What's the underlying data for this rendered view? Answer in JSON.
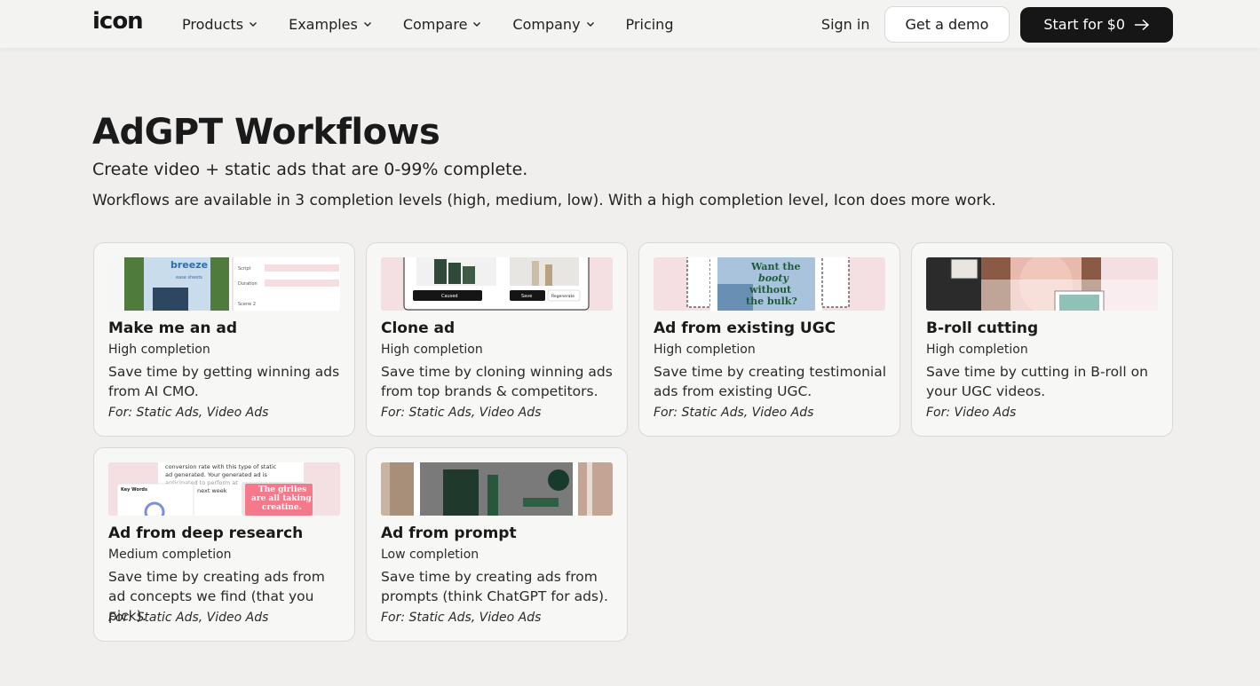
{
  "nav": {
    "logo": "icon",
    "items": [
      {
        "label": "Products"
      },
      {
        "label": "Examples"
      },
      {
        "label": "Compare"
      },
      {
        "label": "Company"
      },
      {
        "label": "Pricing"
      }
    ],
    "signin": "Sign in",
    "demo": "Get a demo",
    "start": "Start for $0"
  },
  "hero": {
    "title": "AdGPT Workflows",
    "subtitle": "Create video + static ads that are 0-99% complete.",
    "description": "Workflows are available in 3 completion levels (high, medium, low). With a high completion level, Icon does more work."
  },
  "cards": [
    {
      "title": "Make me an ad",
      "level": "High completion",
      "desc": "Save time by getting winning ads from AI CMO.",
      "for": "For: Static Ads, Video Ads"
    },
    {
      "title": "Clone ad",
      "level": "High completion",
      "desc": "Save time by cloning winning ads from top brands & competitors.",
      "for": "For: Static Ads, Video Ads"
    },
    {
      "title": "Ad from existing UGC",
      "level": "High completion",
      "desc": "Save time by creating testimonial ads from existing UGC.",
      "for": "For: Static Ads, Video Ads"
    },
    {
      "title": "B-roll cutting",
      "level": "High completion",
      "desc": "Save time by cutting in B-roll on your UGC videos.",
      "for": "For: Video Ads"
    },
    {
      "title": "Ad from deep research",
      "level": "Medium completion",
      "desc": "Save time by creating ads from ad concepts we find (that you pick).",
      "for": "For: Static Ads, Video Ads"
    },
    {
      "title": "Ad from prompt",
      "level": "Low completion",
      "desc": "Save time by creating ads from prompts (think ChatGPT for ads).",
      "for": "For: Static Ads, Video Ads"
    }
  ],
  "thumb_text": {
    "t1_brand": "breeze",
    "t1_sub": "ease sheets",
    "t1_script": "Script",
    "t1_duration": "Duration",
    "t1_scene": "Scene 2",
    "t2_btn": "Caused",
    "t2_btn2": "Save",
    "t2_btn3": "Regenerate",
    "t3_line1": "Want the",
    "t3_line2": "booty",
    "t3_line3": "without",
    "t3_line4": "the bulk?",
    "t5_top1": "conversion rate with this type of static",
    "t5_top2": "ad generated. Your generated ad is",
    "t5_top3": "anticipated to perform at",
    "t5_top4": "next week",
    "t5_keywords": "Key Words",
    "t5_girlies1": "The girlies",
    "t5_girlies2": "are all taking",
    "t5_girlies3": "creatine."
  },
  "colors": {
    "background": "#f0efed",
    "card": "#f7f7f6",
    "dark_button": "#161616"
  }
}
